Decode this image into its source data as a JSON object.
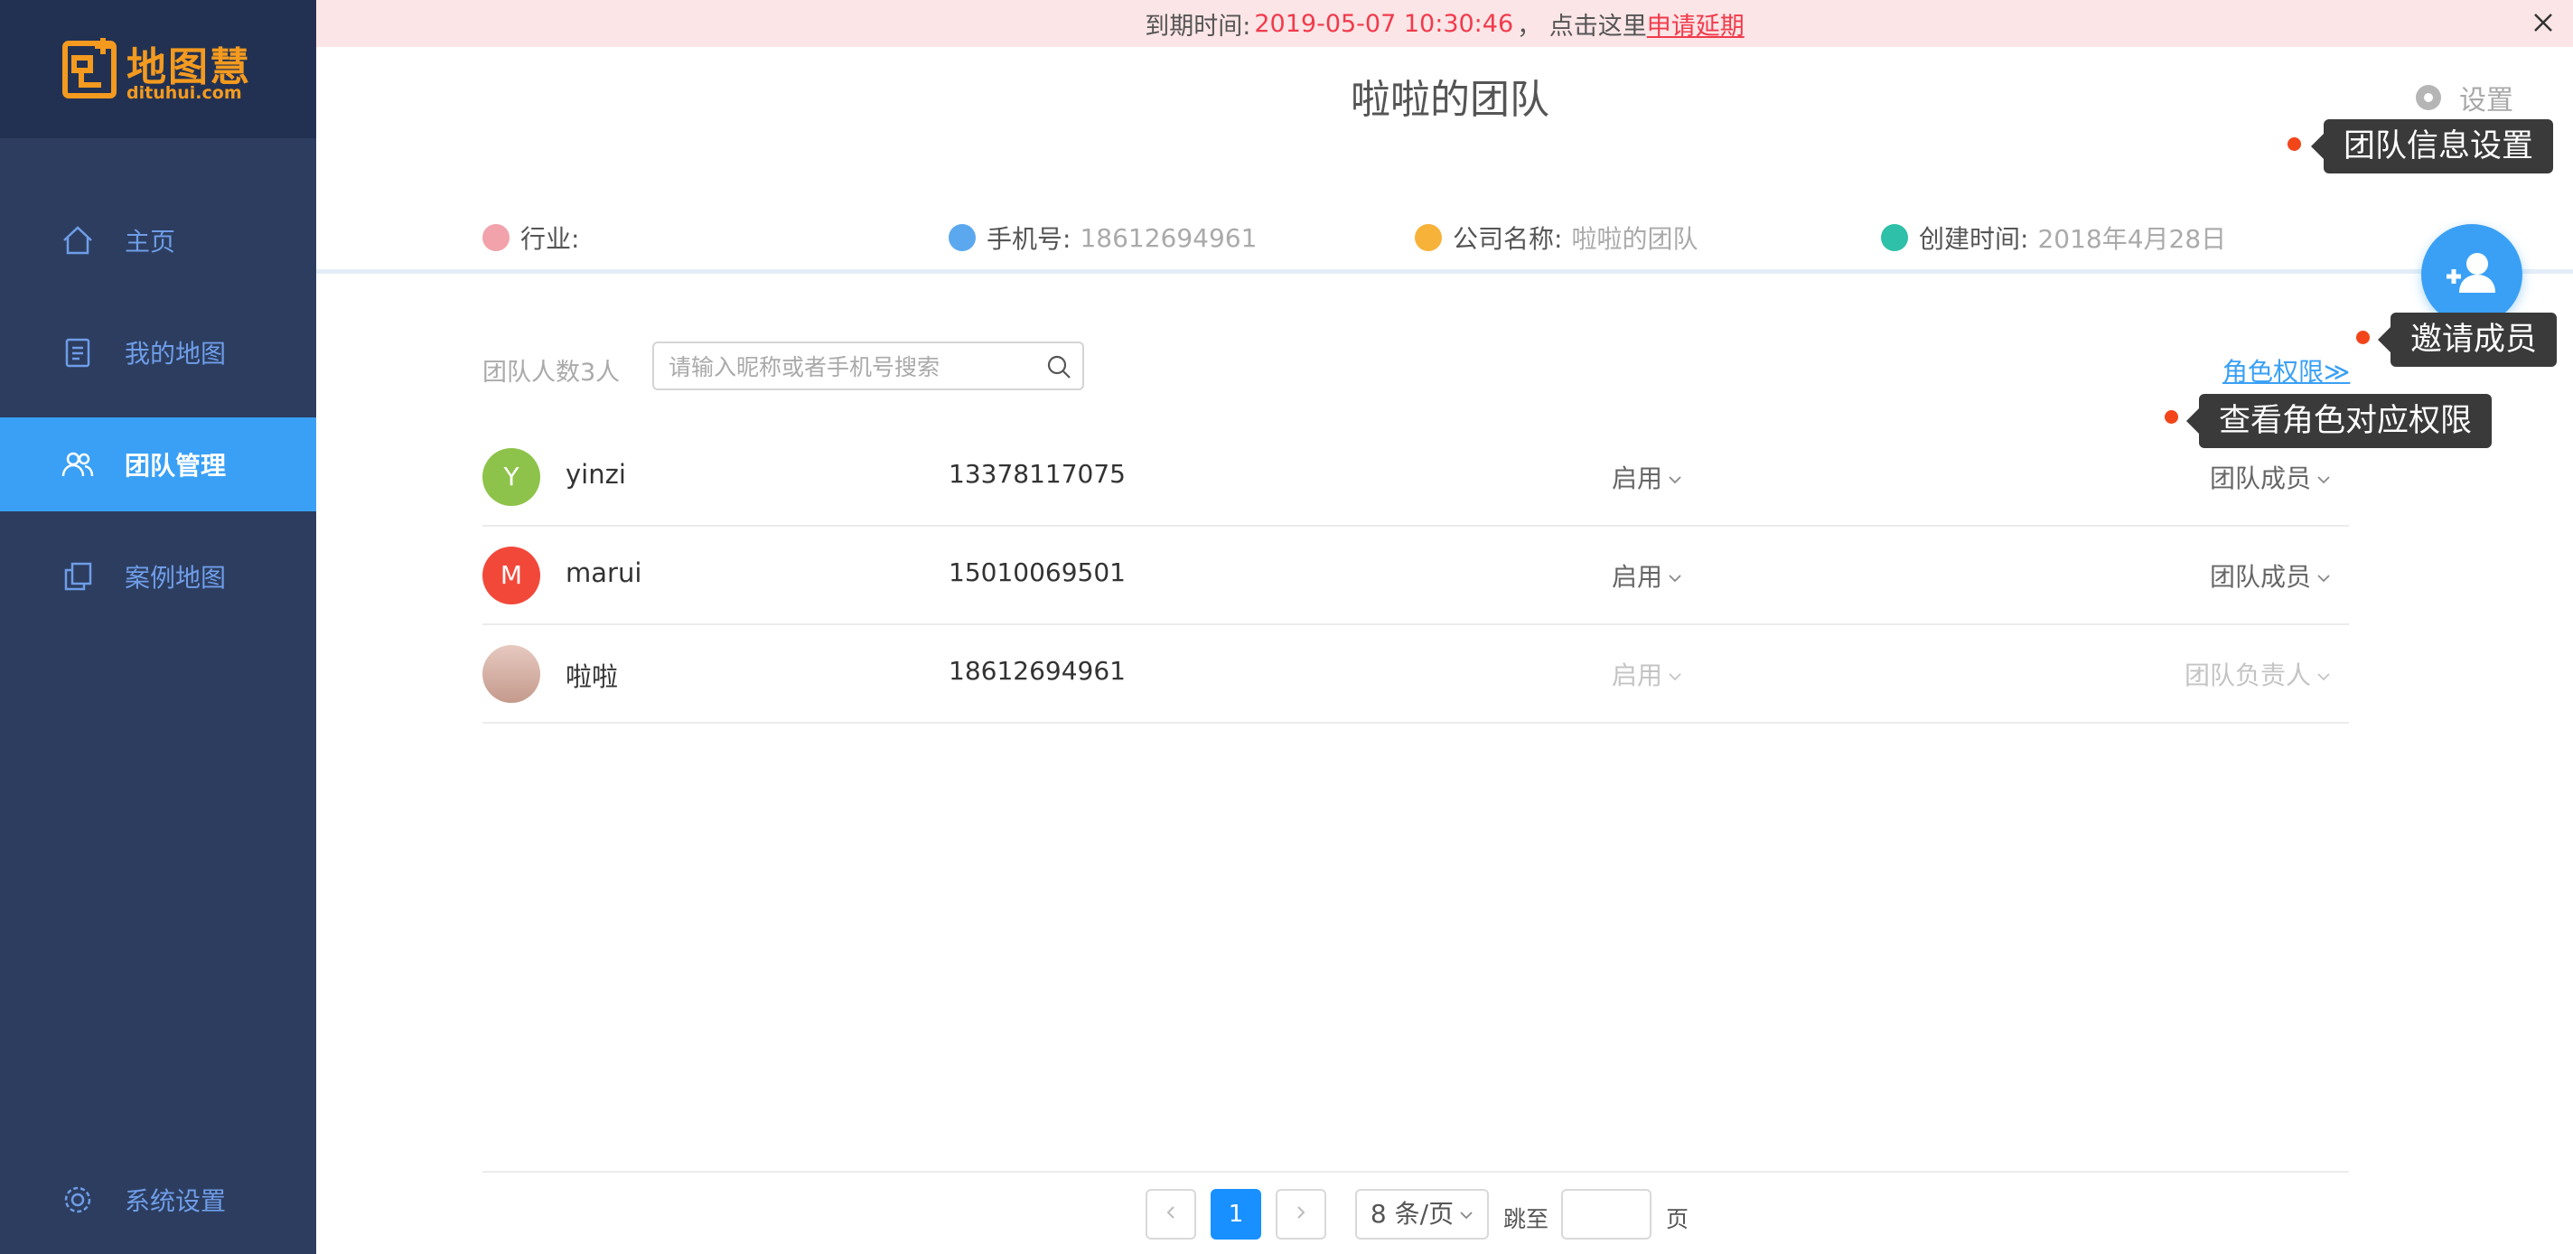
{
  "brand": {
    "name": "地图慧",
    "domain": "dituhui.com",
    "color": "#f39a1f"
  },
  "sidebar": {
    "items": [
      {
        "label": "主页",
        "icon": "home-icon"
      },
      {
        "label": "我的地图",
        "icon": "map-doc-icon"
      },
      {
        "label": "团队管理",
        "icon": "team-icon",
        "active": true
      },
      {
        "label": "案例地图",
        "icon": "copy-icon"
      },
      {
        "label": "系统设置",
        "icon": "gear-icon"
      }
    ]
  },
  "notice": {
    "prefix": "到期时间:",
    "expire_time": "2019-05-07 10:30:46",
    "mid": "， 点击这里",
    "link": "申请延期"
  },
  "page": {
    "title": "啦啦的团队",
    "settings_label": "设置"
  },
  "tips": {
    "team_info": "团队信息设置",
    "invite": "邀请成员",
    "role_perm": "查看角色对应权限"
  },
  "info": {
    "industry_label": "行业:",
    "industry_value": "",
    "phone_label": "手机号:",
    "phone_value": "18612694961",
    "company_label": "公司名称:",
    "company_value": "啦啦的团队",
    "created_label": "创建时间:",
    "created_value": "2018年4月28日"
  },
  "members": {
    "count_label": "团队人数3人",
    "search_placeholder": "请输入昵称或者手机号搜索",
    "role_link": "角色权限≫",
    "rows": [
      {
        "initial": "Y",
        "color": "#8dc34a",
        "name": "yinzi",
        "phone": "13378117075",
        "status": "启用",
        "role": "团队成员"
      },
      {
        "initial": "M",
        "color": "#f2483a",
        "name": "marui",
        "phone": "15010069501",
        "status": "启用",
        "role": "团队成员"
      },
      {
        "initial": "",
        "color": "#e7c9c0",
        "name": "啦啦",
        "phone": "18612694961",
        "status": "启用",
        "role": "团队负责人"
      }
    ]
  },
  "pagination": {
    "current": "1",
    "page_size": "8 条/页",
    "jump_label": "跳至",
    "page_unit": "页",
    "jump_value": ""
  }
}
